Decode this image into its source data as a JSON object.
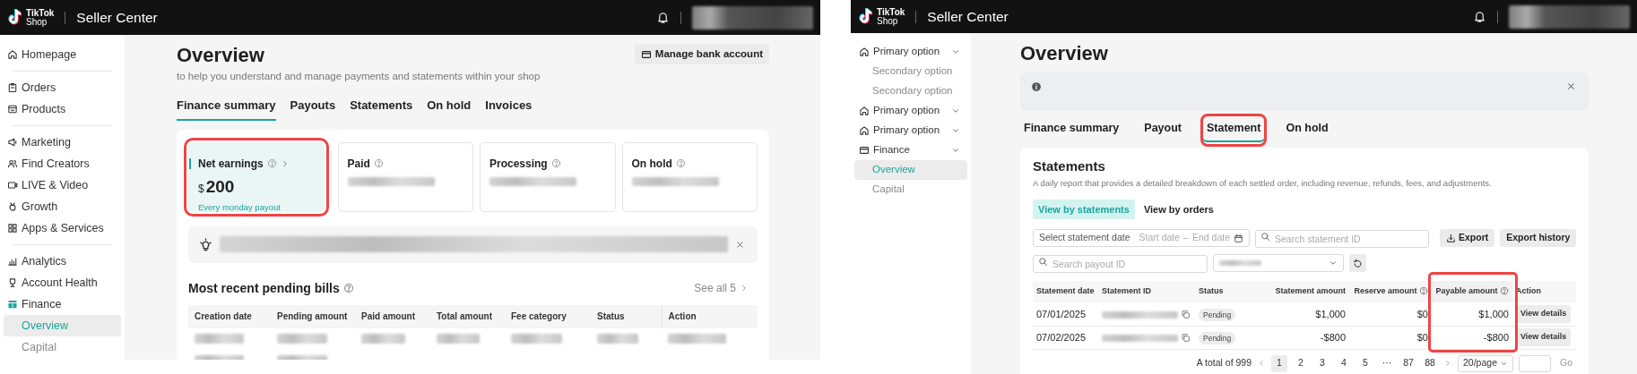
{
  "left_screen": {
    "header": {
      "logo": [
        "TikTok",
        "Shop"
      ],
      "title": "Seller Center"
    },
    "sidebar": {
      "sections": [
        [
          {
            "label": "Homepage"
          }
        ],
        [
          {
            "label": "Orders"
          },
          {
            "label": "Products"
          }
        ],
        [
          {
            "label": "Marketing"
          },
          {
            "label": "Find Creators"
          },
          {
            "label": "LIVE & Video"
          },
          {
            "label": "Growth"
          },
          {
            "label": "Apps & Services"
          }
        ],
        [
          {
            "label": "Analytics"
          },
          {
            "label": "Account Health"
          },
          {
            "label": "Finance",
            "children": [
              {
                "label": "Overview",
                "selected": true
              },
              {
                "label": "Capital",
                "selected": false
              }
            ]
          }
        ]
      ]
    },
    "page": {
      "title": "Overview",
      "subtitle": "to help you understand and manage payments and statements within your shop",
      "action_button": "Manage bank account"
    },
    "tabs": [
      {
        "label": "Finance summary",
        "selected": true
      },
      {
        "label": "Payouts",
        "selected": false
      },
      {
        "label": "Statements",
        "selected": false
      },
      {
        "label": "On hold",
        "selected": false
      },
      {
        "label": "Invoices",
        "selected": false
      }
    ],
    "stat_cards": [
      {
        "label": "Net earnings",
        "selected": true,
        "highlighted": true,
        "currency": "$",
        "value": "200",
        "note": "Every monday payout"
      },
      {
        "label": "Paid",
        "selected": false,
        "highlighted": false
      },
      {
        "label": "Processing",
        "selected": false,
        "highlighted": false
      },
      {
        "label": "On hold",
        "selected": false,
        "highlighted": false
      }
    ],
    "section": {
      "title": "Most recent pending bills",
      "link": "See all 5"
    },
    "table": {
      "columns": [
        "Creation date",
        "Pending amount",
        "Paid amount",
        "Total amount",
        "Fee category",
        "Status",
        "Action"
      ]
    }
  },
  "right_screen": {
    "header": {
      "logo": [
        "TikTok",
        "Shop"
      ],
      "title": "Seller Center"
    },
    "sidebar": {
      "items": [
        {
          "label": "Primary option",
          "children": [
            {
              "label": "Secondary option",
              "selected": false
            },
            {
              "label": "Secondary option",
              "selected": false
            }
          ]
        },
        {
          "label": "Primary option"
        },
        {
          "label": "Primary option"
        },
        {
          "label": "Finance",
          "children": [
            {
              "label": "Overview",
              "selected": true
            },
            {
              "label": "Capital",
              "selected": false
            }
          ]
        }
      ]
    },
    "page": {
      "title": "Overview"
    },
    "tabs": [
      {
        "label": "Finance summary",
        "selected": false,
        "highlighted": false
      },
      {
        "label": "Payout",
        "selected": false,
        "highlighted": false
      },
      {
        "label": "Statement",
        "selected": true,
        "highlighted": true
      },
      {
        "label": "On hold",
        "selected": false,
        "highlighted": false
      }
    ],
    "statements": {
      "title": "Statements",
      "description": "A daily report that provides a detailed breakdown of each settled order, including revenue, refunds, fees, and adjustments.",
      "views": [
        {
          "label": "View by statements",
          "selected": true
        },
        {
          "label": "View by orders",
          "selected": false
        }
      ],
      "date_filter": {
        "label": "Select statement date",
        "start": "Start date",
        "separator": "–",
        "end": "End date"
      },
      "statement_search": {
        "placeholder": "Search statement ID"
      },
      "payout_search": {
        "placeholder": "Search payout ID"
      },
      "buttons": [
        "Export",
        "Export history"
      ]
    },
    "table": {
      "columns": [
        {
          "label": "Statement date",
          "help": false
        },
        {
          "label": "Statement ID",
          "help": false
        },
        {
          "label": "Status",
          "help": false
        },
        {
          "label": "Statement amount",
          "help": false
        },
        {
          "label": "Reserve amount",
          "help": true
        },
        {
          "label": "Payable amount",
          "help": true,
          "highlighted": true
        },
        {
          "label": "Action",
          "help": false
        }
      ],
      "rows": [
        {
          "date": "07/01/2025",
          "status": "Pending",
          "statement_amount": "$1,000",
          "reserve_amount": "$0",
          "payable_amount": "$1,000",
          "action": "View details"
        },
        {
          "date": "07/02/2025",
          "status": "Pending",
          "statement_amount": "-$800",
          "reserve_amount": "$0",
          "payable_amount": "-$800",
          "action": "View details"
        }
      ]
    },
    "pagination": {
      "total": "A total of 999",
      "pages": [
        {
          "label": "1",
          "selected": true
        },
        {
          "label": "2",
          "selected": false
        },
        {
          "label": "3",
          "selected": false
        },
        {
          "label": "4",
          "selected": false
        },
        {
          "label": "5",
          "selected": false
        },
        {
          "label": "···",
          "selected": false
        },
        {
          "label": "87",
          "selected": false
        },
        {
          "label": "88",
          "selected": false
        }
      ],
      "page_size": "20/page",
      "go": "Go"
    }
  }
}
